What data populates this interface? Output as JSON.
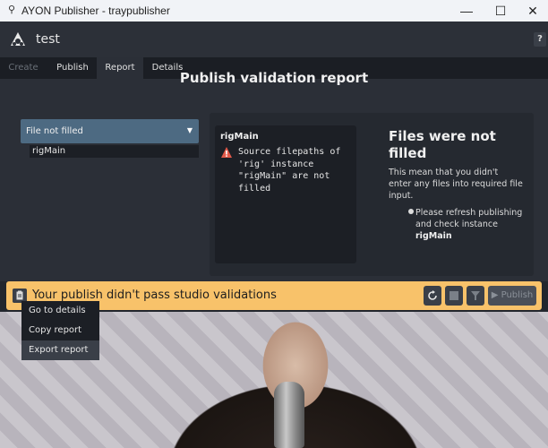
{
  "window": {
    "title": "AYON Publisher - traypublisher",
    "minimize": "—",
    "maximize": "☐",
    "close": "✕"
  },
  "header": {
    "project": "test",
    "help": "?"
  },
  "tabs": [
    {
      "label": "Create",
      "state": "disabled"
    },
    {
      "label": "Publish",
      "state": "normal"
    },
    {
      "label": "Report",
      "state": "active"
    },
    {
      "label": "Details",
      "state": "normal"
    }
  ],
  "report": {
    "title": "Publish validation report",
    "selected_error": "File not filled",
    "instances": [
      "rigMain"
    ],
    "detail": {
      "instance": "rigMain",
      "message": "Source filepaths of\n'rig' instance\n\"rigMain\" are not\nfilled"
    },
    "description": {
      "title": "Files were not filled",
      "text": "This mean that you didn't enter any files into required file input.",
      "bullet_prefix": "Please refresh publishing and check instance ",
      "bullet_bold": "rigMain"
    }
  },
  "status": {
    "message": "Your publish didn't pass studio validations",
    "publish_label": "Publish",
    "bar_color": "#f8c26a"
  },
  "context_menu": [
    "Go to details",
    "Copy report",
    "Export report"
  ],
  "icons": [
    "ayon-logo-icon",
    "clipboard-icon",
    "refresh-icon",
    "stop-icon",
    "validate-icon",
    "play-icon",
    "warning-icon"
  ]
}
